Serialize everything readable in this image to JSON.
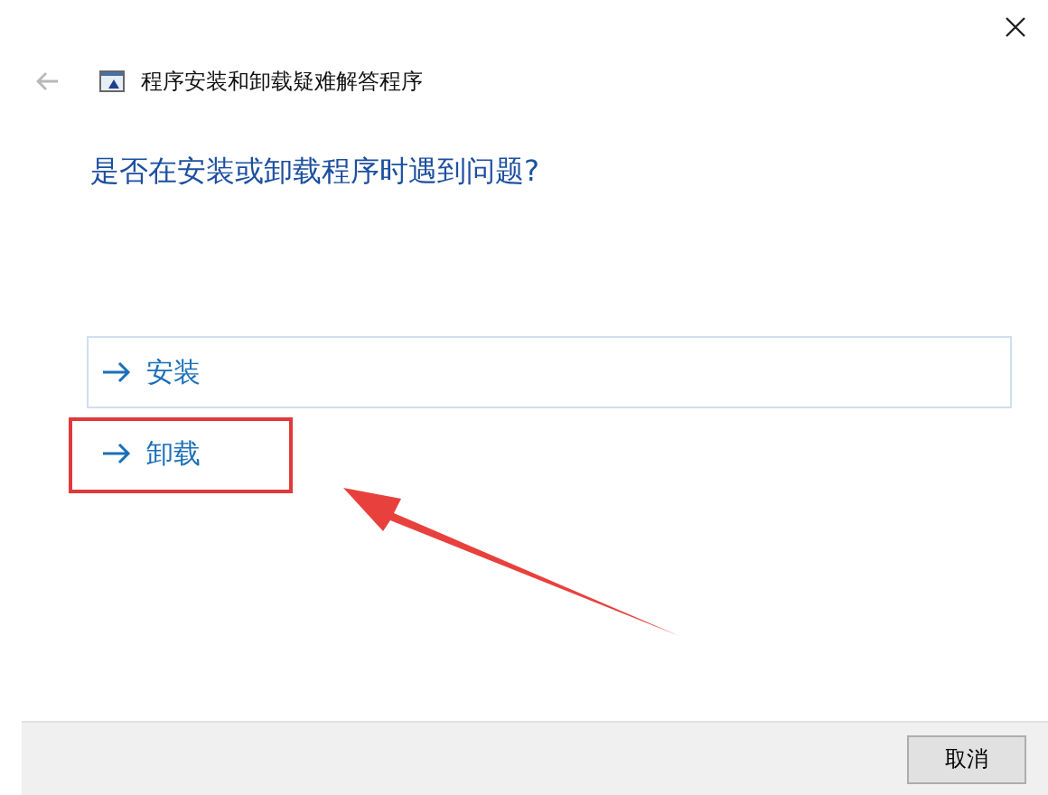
{
  "window": {
    "title": "程序安装和卸载疑难解答程序",
    "back_disabled": true
  },
  "question": "是否在安装或卸载程序时遇到问题?",
  "options": [
    {
      "label": "安装",
      "highlighted": true,
      "annotated": false
    },
    {
      "label": "卸载",
      "highlighted": false,
      "annotated": true
    }
  ],
  "buttons": [
    "取消"
  ]
}
